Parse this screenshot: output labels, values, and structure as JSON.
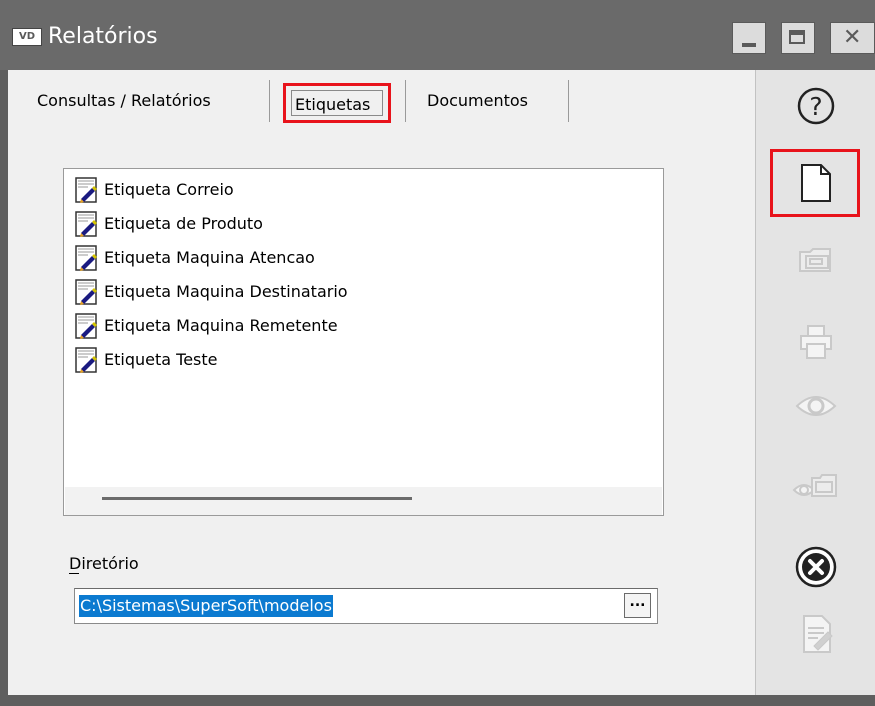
{
  "window": {
    "app_badge": "VD",
    "title": "Relatórios"
  },
  "tabs": [
    {
      "label": "Consultas / Relatórios",
      "selected": false
    },
    {
      "label": "Etiquetas",
      "selected": true
    },
    {
      "label": "Documentos",
      "selected": false
    }
  ],
  "list": {
    "items": [
      "Etiqueta Correio",
      "Etiqueta de Produto",
      "Etiqueta Maquina Atencao",
      "Etiqueta Maquina Destinatario",
      "Etiqueta Maquina Remetente",
      "Etiqueta Teste"
    ]
  },
  "directory": {
    "label": "Diretório",
    "value": "C:\\Sistemas\\SuperSoft\\modelos",
    "browse_label": "..."
  },
  "sidebar": {
    "buttons": [
      {
        "name": "help",
        "icon": "question-circle-icon",
        "enabled": true
      },
      {
        "name": "new",
        "icon": "blank-document-icon",
        "enabled": true,
        "highlighted": true
      },
      {
        "name": "open",
        "icon": "folder-open-icon",
        "enabled": false
      },
      {
        "name": "print",
        "icon": "printer-icon",
        "enabled": false
      },
      {
        "name": "preview",
        "icon": "eye-icon",
        "enabled": false
      },
      {
        "name": "preview-folder",
        "icon": "eye-folder-icon",
        "enabled": false
      },
      {
        "name": "cancel",
        "icon": "close-circle-icon",
        "enabled": true
      },
      {
        "name": "edit",
        "icon": "edit-document-icon",
        "enabled": false
      }
    ]
  },
  "colors": {
    "titlebar": "#6a6a6a",
    "highlight": "#e8131b",
    "selection": "#0b7ad0",
    "disabled_icon": "#c9c9c9"
  }
}
